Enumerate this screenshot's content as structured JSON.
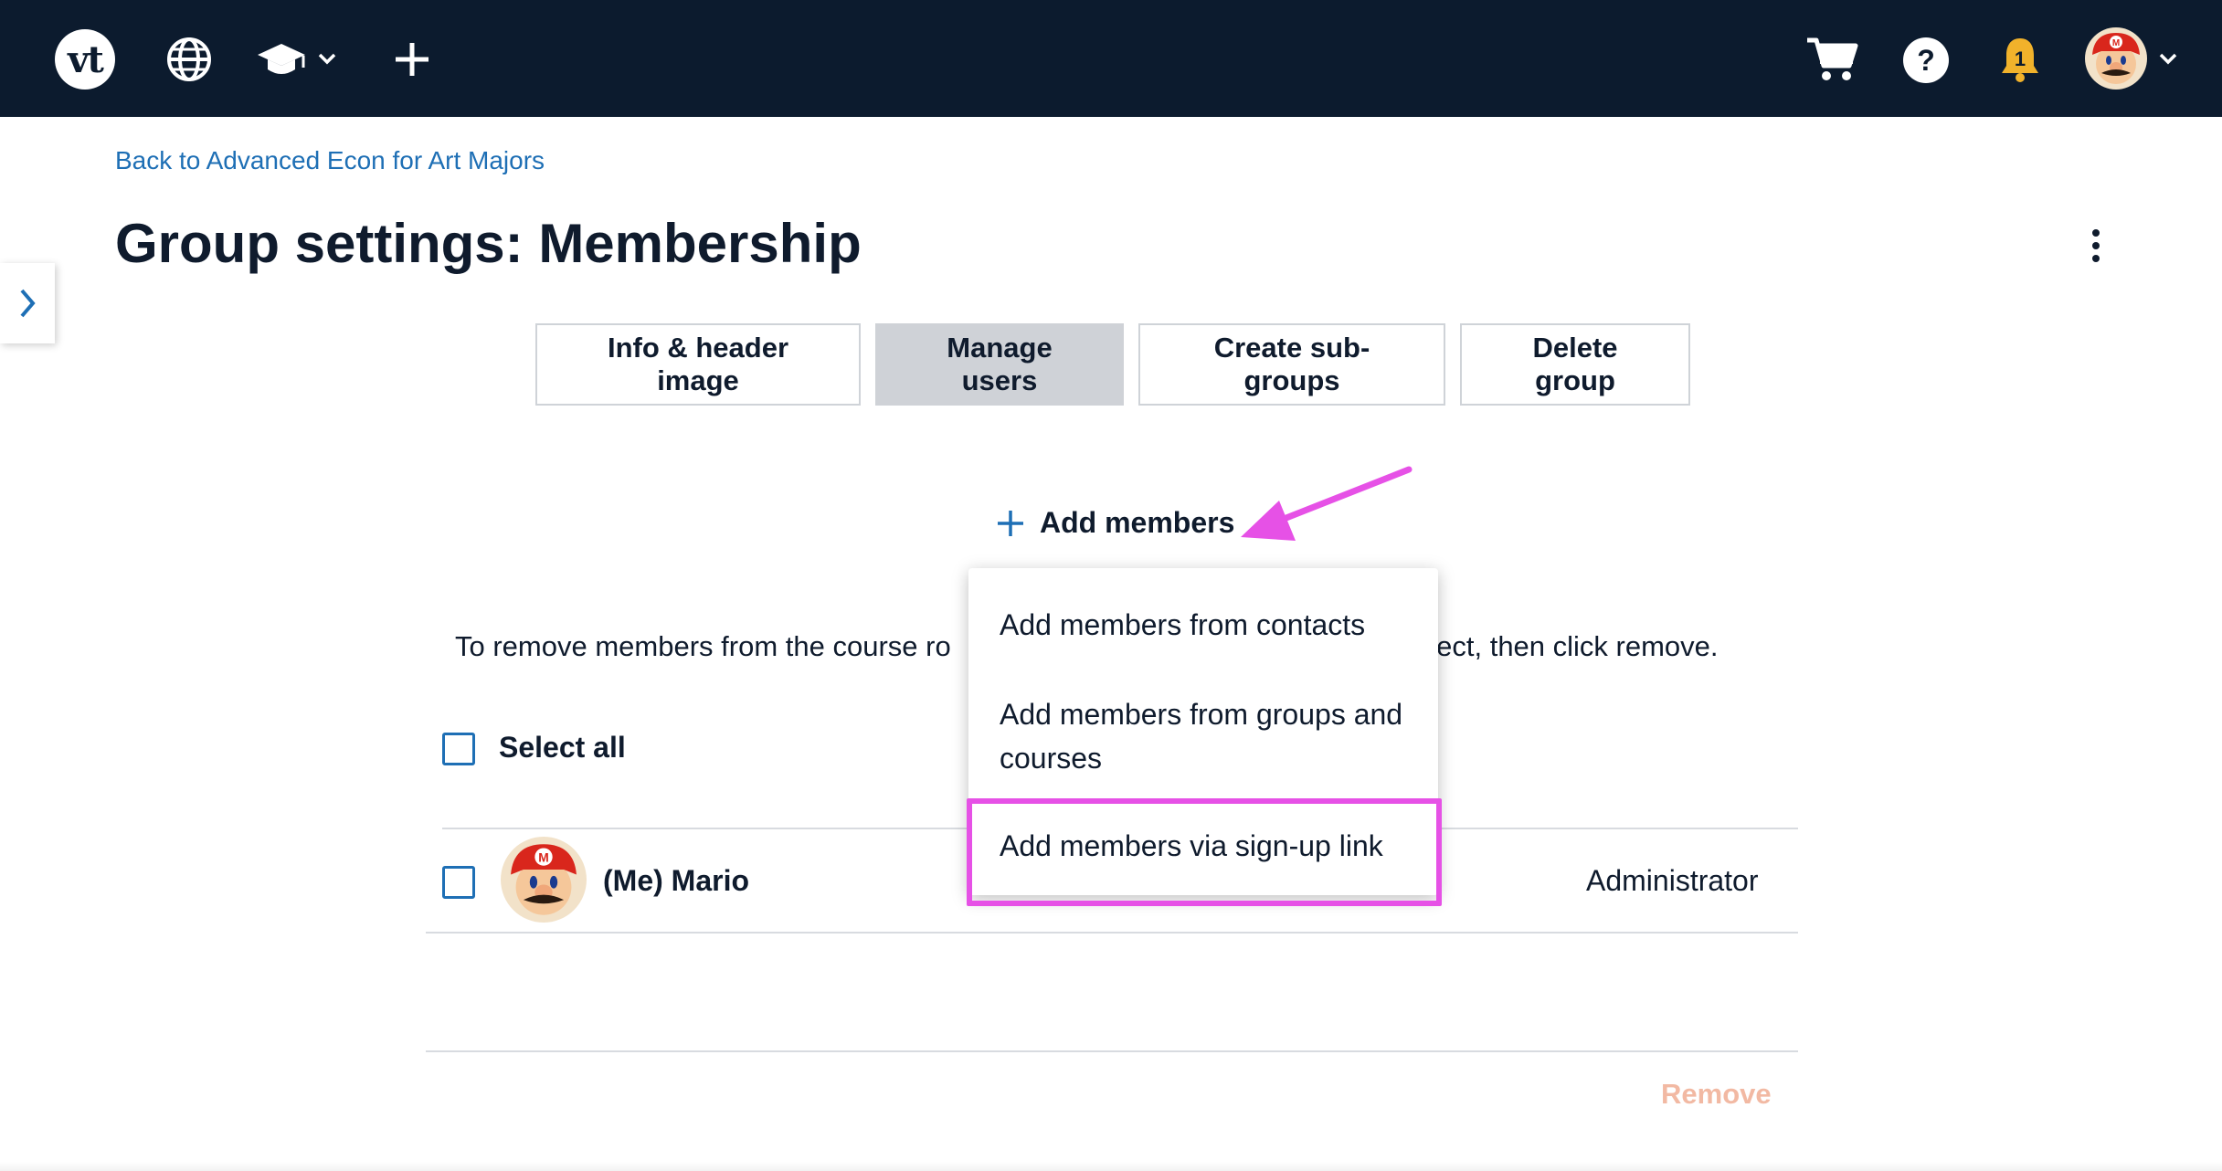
{
  "colors": {
    "nav_bg": "#0c1b2e",
    "link": "#1e6fb5",
    "title": "#0f1b2d",
    "active_tab_bg": "#cfd2d7",
    "remove_disabled": "#f2b9a3",
    "annotation": "#e651e6",
    "bell": "#f1b22b"
  },
  "nav": {
    "logo_text": "vt",
    "icons": [
      "globe-icon",
      "graduation-cap-icon",
      "plus-icon",
      "cart-icon",
      "help-icon",
      "bell-icon",
      "user-avatar"
    ]
  },
  "back_link": "Back to Advanced Econ for Art Majors",
  "page_title": "Group settings: Membership",
  "tabs": [
    {
      "label": "Info & header image",
      "active": false
    },
    {
      "label": "Manage users",
      "active": true
    },
    {
      "label": "Create sub-groups",
      "active": false
    },
    {
      "label": "Delete group",
      "active": false
    }
  ],
  "add_members_label": "Add members",
  "instructions_left": "To remove members from the course ro",
  "instructions_right": "elect, then click remove.",
  "select_all_label": "Select all",
  "members": [
    {
      "name": "(Me) Mario",
      "role": "Administrator"
    }
  ],
  "remove_label": "Remove",
  "dropdown": {
    "items": [
      "Add members from contacts",
      "Add members from groups and courses",
      "Add members via sign-up link"
    ],
    "highlighted_item": "Add members via sign-up link"
  }
}
